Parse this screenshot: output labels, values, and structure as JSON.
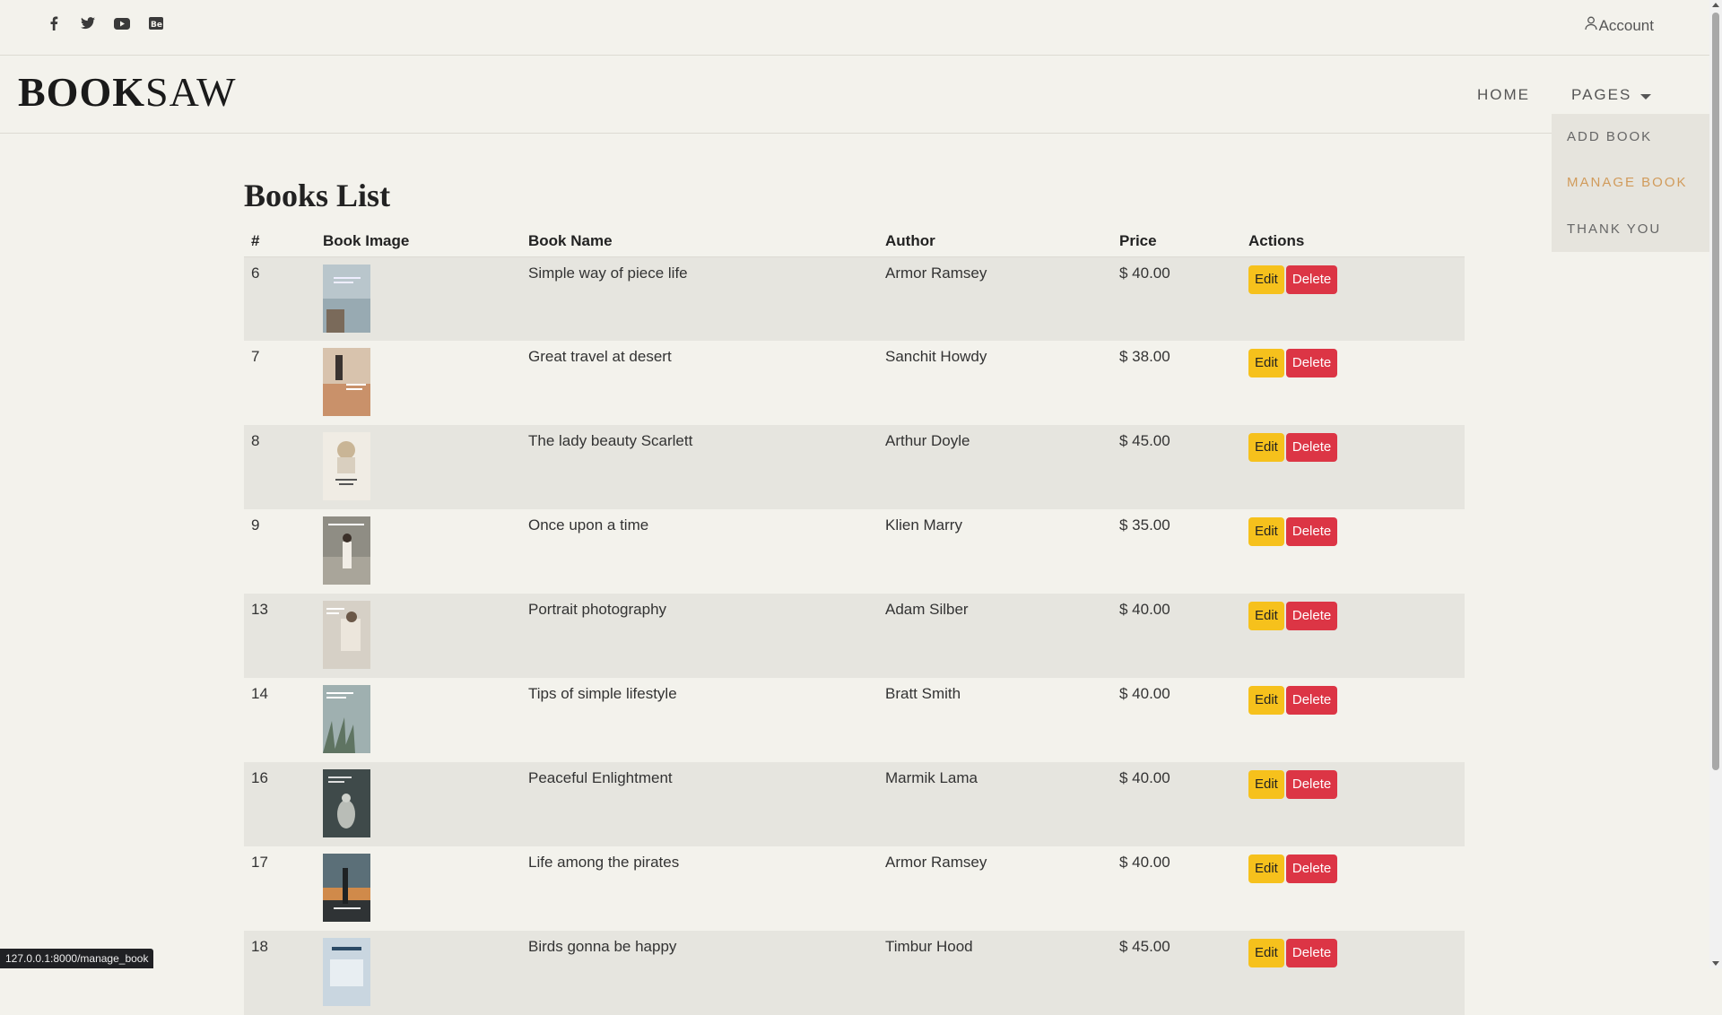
{
  "topbar": {
    "social": [
      {
        "name": "facebook-icon"
      },
      {
        "name": "twitter-icon"
      },
      {
        "name": "youtube-icon"
      },
      {
        "name": "behance-icon"
      }
    ],
    "account_label": "Account"
  },
  "header": {
    "logo_bold": "BOOK",
    "logo_thin": "SAW",
    "nav": {
      "home": "HOME",
      "pages": "PAGES"
    },
    "dropdown": [
      {
        "label": "ADD BOOK",
        "active": false
      },
      {
        "label": "MANAGE BOOK",
        "active": true
      },
      {
        "label": "THANK YOU",
        "active": false
      }
    ]
  },
  "main": {
    "title": "Books List",
    "columns": [
      "#",
      "Book Image",
      "Book Name",
      "Author",
      "Price",
      "Actions"
    ],
    "edit_label": "Edit",
    "delete_label": "Delete",
    "rows": [
      {
        "id": "6",
        "name": "Simple way of piece life",
        "author": "Armor Ramsey",
        "price": "$ 40.00"
      },
      {
        "id": "7",
        "name": "Great travel at desert",
        "author": "Sanchit Howdy",
        "price": "$ 38.00"
      },
      {
        "id": "8",
        "name": "The lady beauty Scarlett",
        "author": "Arthur Doyle",
        "price": "$ 45.00"
      },
      {
        "id": "9",
        "name": "Once upon a time",
        "author": "Klien Marry",
        "price": "$ 35.00"
      },
      {
        "id": "13",
        "name": "Portrait photography",
        "author": "Adam Silber",
        "price": "$ 40.00"
      },
      {
        "id": "14",
        "name": "Tips of simple lifestyle",
        "author": "Bratt Smith",
        "price": "$ 40.00"
      },
      {
        "id": "16",
        "name": "Peaceful Enlightment",
        "author": "Marmik Lama",
        "price": "$ 40.00"
      },
      {
        "id": "17",
        "name": "Life among the pirates",
        "author": "Armor Ramsey",
        "price": "$ 40.00"
      },
      {
        "id": "18",
        "name": "Birds gonna be happy",
        "author": "Timbur Hood",
        "price": "$ 45.00"
      }
    ]
  },
  "status_url": "127.0.0.1:8000/manage_book",
  "colors": {
    "background": "#f3f2ec",
    "stripe": "#e6e5df",
    "accent": "#d19b5b",
    "edit": "#f6c11c",
    "delete": "#dc3545"
  }
}
